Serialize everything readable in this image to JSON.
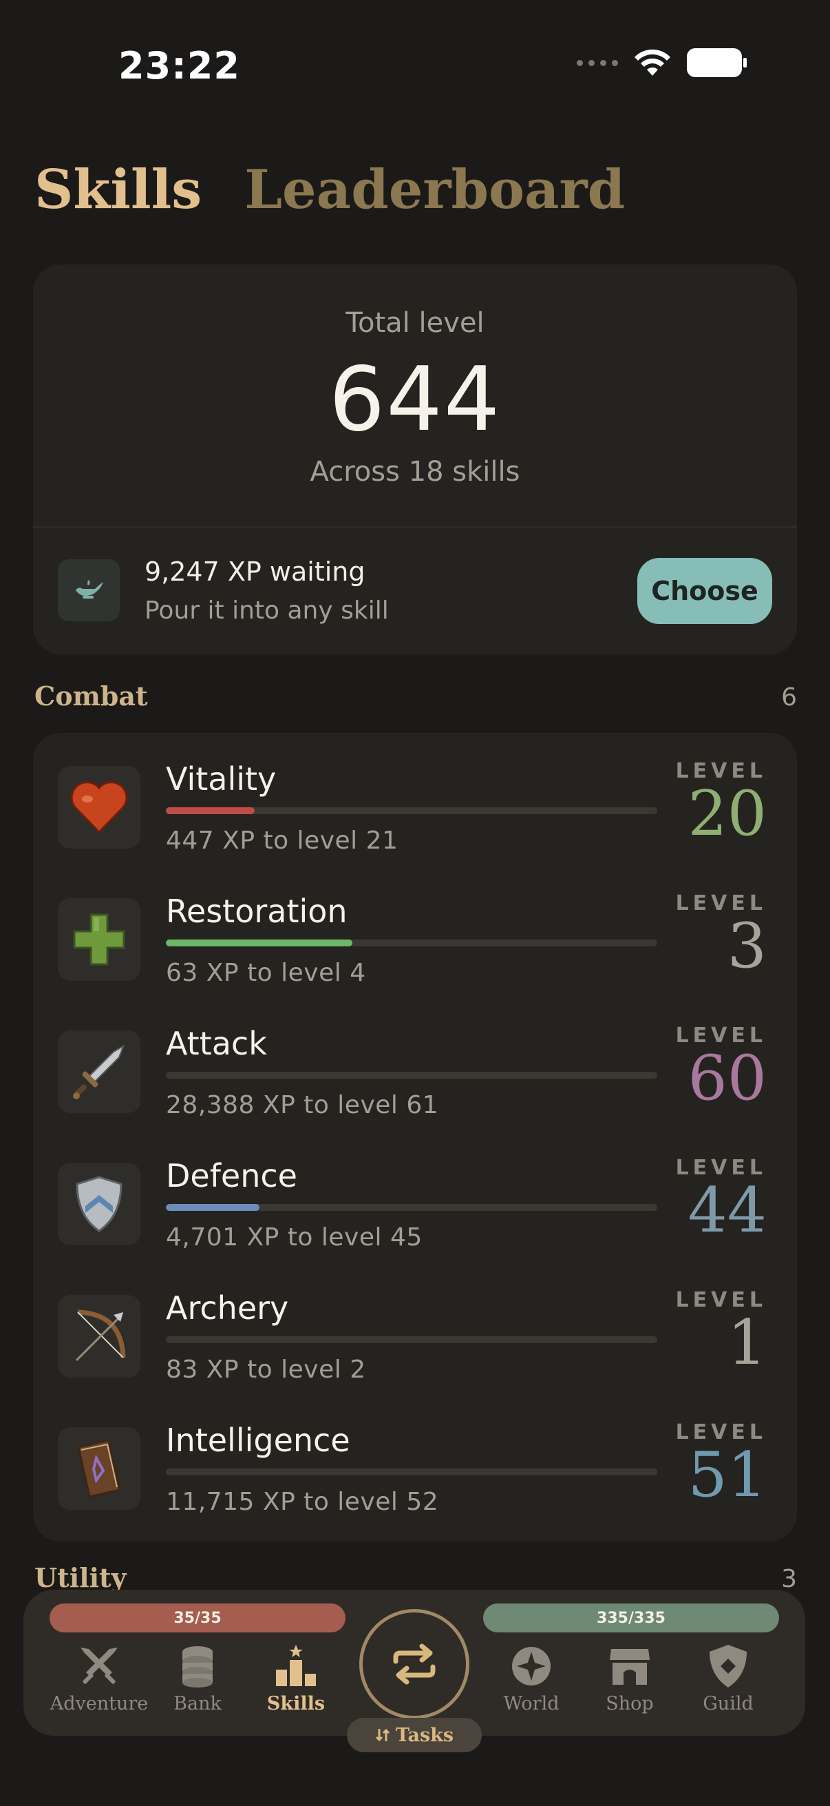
{
  "status_bar": {
    "time": "23:22"
  },
  "tabs": [
    {
      "label": "Skills",
      "active": true
    },
    {
      "label": "Leaderboard",
      "active": false
    }
  ],
  "summary": {
    "label": "Total level",
    "value": "644",
    "subtitle": "Across 18 skills",
    "xp_title": "9,247 XP waiting",
    "xp_subtitle": "Pour it into any skill",
    "choose_label": "Choose"
  },
  "sections": {
    "combat": {
      "title": "Combat",
      "count": "6"
    },
    "utility": {
      "title": "Utility",
      "count": "3"
    }
  },
  "skills": [
    {
      "name": "Vitality",
      "xp_text": "447 XP to level 21",
      "level_label": "LEVEL",
      "level": "20",
      "level_color": "#8faf72",
      "bar_color": "#c14c45",
      "progress": 0.18,
      "icon": "heart-icon"
    },
    {
      "name": "Restoration",
      "xp_text": "63 XP to level 4",
      "level_label": "LEVEL",
      "level": "3",
      "level_color": "#a7a39a",
      "bar_color": "#6cb76a",
      "progress": 0.38,
      "icon": "plus-icon"
    },
    {
      "name": "Attack",
      "xp_text": "28,388 XP to level 61",
      "level_label": "LEVEL",
      "level": "60",
      "level_color": "#a8789d",
      "bar_color": "#a8789d",
      "progress": 0.0,
      "icon": "sword-icon"
    },
    {
      "name": "Defence",
      "xp_text": "4,701 XP to level 45",
      "level_label": "LEVEL",
      "level": "44",
      "level_color": "#7e9aa9",
      "bar_color": "#6c8db9",
      "progress": 0.19,
      "icon": "shield-icon"
    },
    {
      "name": "Archery",
      "xp_text": "83 XP to level 2",
      "level_label": "LEVEL",
      "level": "1",
      "level_color": "#a7a39a",
      "bar_color": "#a7a39a",
      "progress": 0.0,
      "icon": "bow-icon"
    },
    {
      "name": "Intelligence",
      "xp_text": "11,715 XP to level 52",
      "level_label": "LEVEL",
      "level": "51",
      "level_color": "#6f9ab0",
      "bar_color": "#6f9ab0",
      "progress": 0.0,
      "icon": "book-icon"
    }
  ],
  "bottom_nav": {
    "hp": "35/35",
    "mp": "335/335",
    "items": [
      {
        "label": "Adventure",
        "icon": "crossed-swords-icon"
      },
      {
        "label": "Bank",
        "icon": "coins-icon"
      },
      {
        "label": "Skills",
        "icon": "podium-icon",
        "active": true
      },
      {
        "label": "World",
        "icon": "compass-icon"
      },
      {
        "label": "Shop",
        "icon": "shop-icon"
      },
      {
        "label": "Guild",
        "icon": "guild-shield-icon"
      }
    ],
    "tasks_label": "Tasks"
  }
}
